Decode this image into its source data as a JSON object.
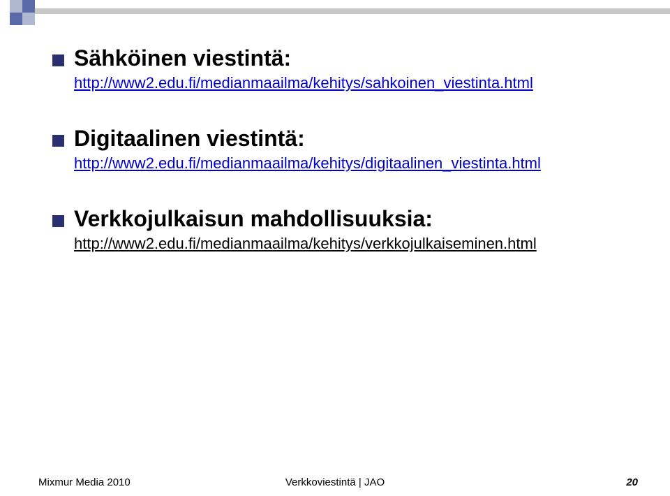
{
  "items": [
    {
      "heading": "Sähköinen viestintä:",
      "link": "http://www2.edu.fi/medianmaailma/kehitys/sahkoinen_viestinta.html"
    },
    {
      "heading": "Digitaalinen viestintä:",
      "link": "http://www2.edu.fi/medianmaailma/kehitys/digitaalinen_viestinta.html"
    },
    {
      "heading": "Verkkojulkaisun mahdollisuuksia:",
      "link": "http://www2.edu.fi/medianmaailma/kehitys/verkkojulkaiseminen.html",
      "link_plain": true
    }
  ],
  "footer": {
    "left": "Mixmur Media 2010",
    "center": "Verkkoviestintä | JAO",
    "page": "20"
  }
}
